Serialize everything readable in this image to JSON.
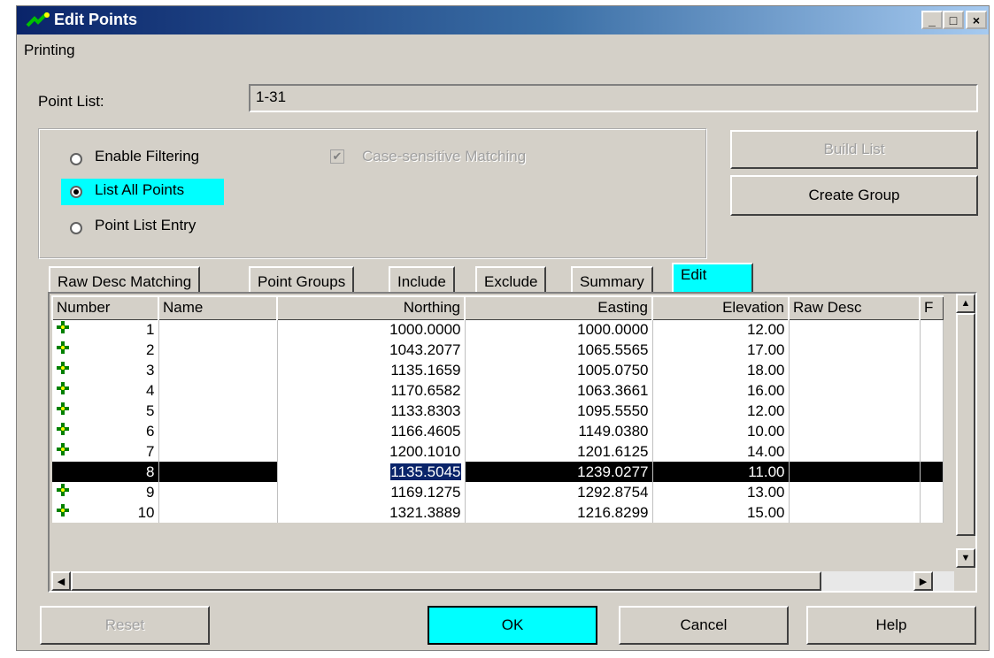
{
  "window": {
    "title": "Edit Points",
    "controls": {
      "minimize": "_",
      "maximize": "□",
      "close": "×"
    }
  },
  "menu": {
    "printing": "Printing"
  },
  "point_list": {
    "label": "Point List:",
    "value": "1-31"
  },
  "filter": {
    "enable_filtering": "Enable Filtering",
    "list_all_points": "List All Points",
    "point_list_entry": "Point List Entry",
    "case_sensitive": "Case-sensitive Matching",
    "selected": "list_all_points"
  },
  "buttons": {
    "build_list": "Build List",
    "create_group": "Create Group",
    "reset": "Reset",
    "ok": "OK",
    "cancel": "Cancel",
    "help": "Help"
  },
  "tabs": [
    "Raw Desc Matching",
    "Point Groups",
    "Include",
    "Exclude",
    "Summary",
    "Edit"
  ],
  "table": {
    "columns": [
      "Number",
      "Name",
      "Northing",
      "Easting",
      "Elevation",
      "Raw Desc",
      "F"
    ],
    "rows": [
      {
        "number": "1",
        "name": "",
        "northing": "1000.0000",
        "easting": "1000.0000",
        "elevation": "12.00",
        "raw_desc": ""
      },
      {
        "number": "2",
        "name": "",
        "northing": "1043.2077",
        "easting": "1065.5565",
        "elevation": "17.00",
        "raw_desc": ""
      },
      {
        "number": "3",
        "name": "",
        "northing": "1135.1659",
        "easting": "1005.0750",
        "elevation": "18.00",
        "raw_desc": ""
      },
      {
        "number": "4",
        "name": "",
        "northing": "1170.6582",
        "easting": "1063.3661",
        "elevation": "16.00",
        "raw_desc": ""
      },
      {
        "number": "5",
        "name": "",
        "northing": "1133.8303",
        "easting": "1095.5550",
        "elevation": "12.00",
        "raw_desc": ""
      },
      {
        "number": "6",
        "name": "",
        "northing": "1166.4605",
        "easting": "1149.0380",
        "elevation": "10.00",
        "raw_desc": ""
      },
      {
        "number": "7",
        "name": "",
        "northing": "1200.1010",
        "easting": "1201.6125",
        "elevation": "14.00",
        "raw_desc": ""
      },
      {
        "number": "8",
        "name": "",
        "northing": "1135.5045",
        "easting": "1239.0277",
        "elevation": "11.00",
        "raw_desc": ""
      },
      {
        "number": "9",
        "name": "",
        "northing": "1169.1275",
        "easting": "1292.8754",
        "elevation": "13.00",
        "raw_desc": ""
      },
      {
        "number": "10",
        "name": "",
        "northing": "1321.3889",
        "easting": "1216.8299",
        "elevation": "15.00",
        "raw_desc": ""
      }
    ],
    "selected_row": "8"
  },
  "colors": {
    "highlight": "#00ffff",
    "title_bar": "#0a246a",
    "point_icon": "#008000"
  }
}
